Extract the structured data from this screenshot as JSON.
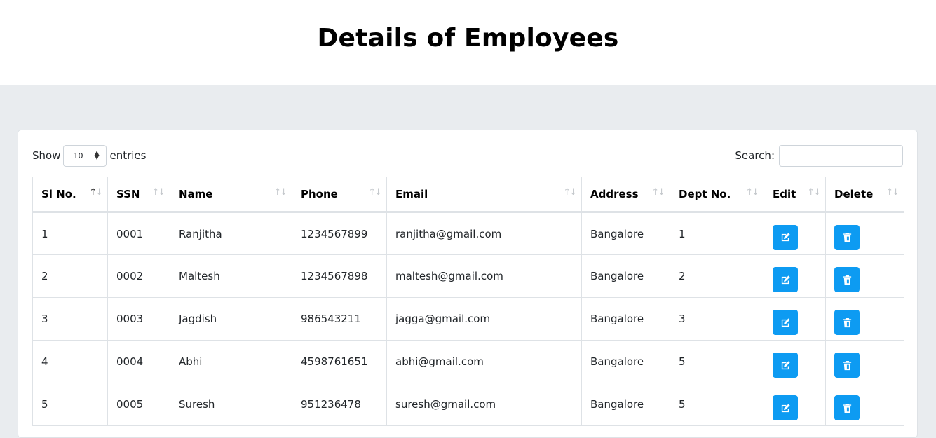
{
  "page": {
    "title": "Details of Employees"
  },
  "length": {
    "show_label": "Show",
    "selected": "10",
    "entries_label": "entries"
  },
  "filter": {
    "label": "Search:",
    "value": ""
  },
  "colors": {
    "button": "#0d9bf2",
    "background": "#e9ecef"
  },
  "table": {
    "headers": [
      "Sl No.",
      "SSN",
      "Name",
      "Phone",
      "Email",
      "Address",
      "Dept No.",
      "Edit",
      "Delete"
    ],
    "sorted_column": "Sl No.",
    "rows": [
      {
        "sl": "1",
        "ssn": "0001",
        "name": "Ranjitha",
        "phone": "1234567899",
        "email": "ranjitha@gmail.com",
        "address": "Bangalore",
        "dept": "1"
      },
      {
        "sl": "2",
        "ssn": "0002",
        "name": "Maltesh",
        "phone": "1234567898",
        "email": "maltesh@gmail.com",
        "address": "Bangalore",
        "dept": "2"
      },
      {
        "sl": "3",
        "ssn": "0003",
        "name": "Jagdish",
        "phone": "986543211",
        "email": "jagga@gmail.com",
        "address": "Bangalore",
        "dept": "3"
      },
      {
        "sl": "4",
        "ssn": "0004",
        "name": "Abhi",
        "phone": "4598761651",
        "email": "abhi@gmail.com",
        "address": "Bangalore",
        "dept": "5"
      },
      {
        "sl": "5",
        "ssn": "0005",
        "name": "Suresh",
        "phone": "951236478",
        "email": "suresh@gmail.com",
        "address": "Bangalore",
        "dept": "5"
      }
    ],
    "row_icons": {
      "edit": "edit-icon",
      "delete": "trash-icon"
    }
  }
}
